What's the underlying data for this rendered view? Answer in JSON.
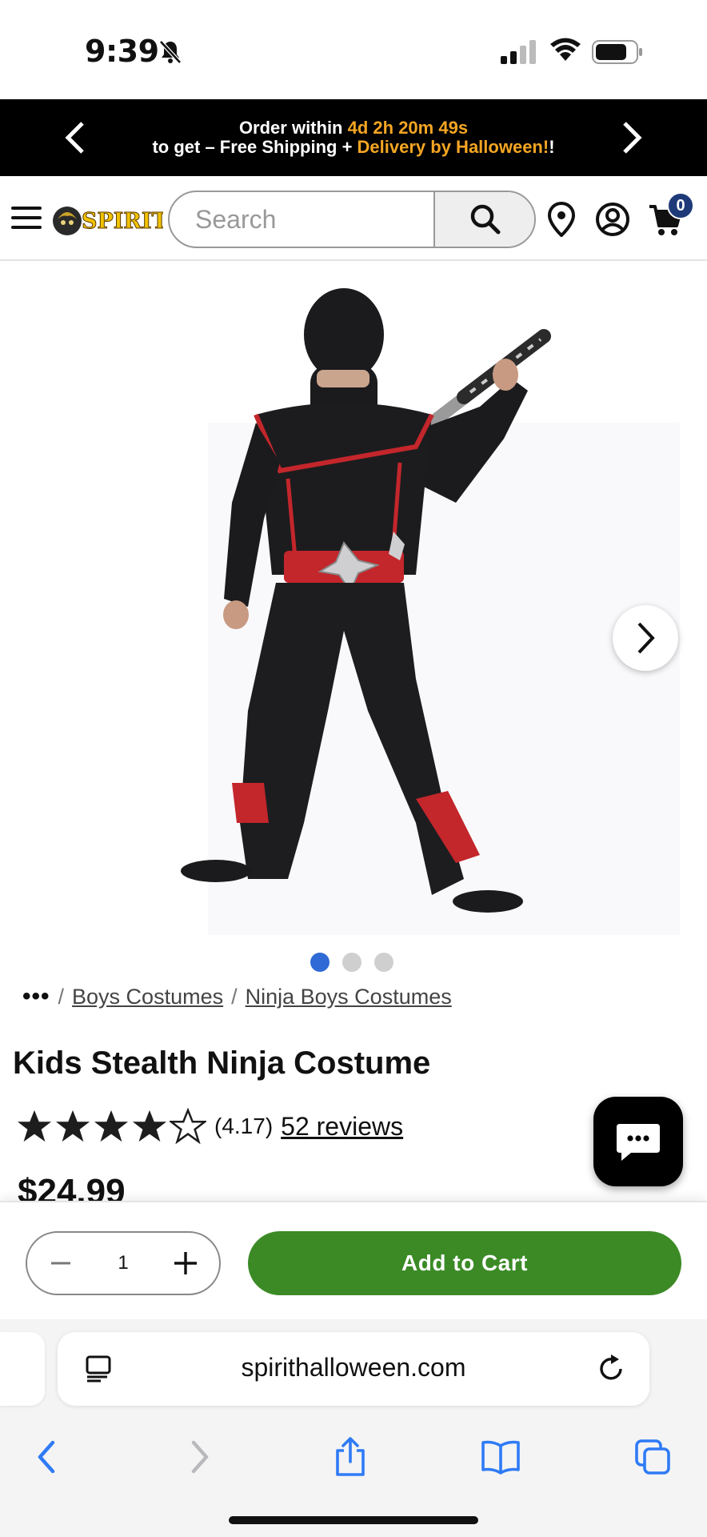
{
  "status_bar": {
    "time": "9:39"
  },
  "promo": {
    "line1_prefix": "Order within ",
    "line1_countdown": "4d 2h 20m 49s",
    "line2_prefix": "to get – Free Shipping + ",
    "line2_highlight": "Delivery by Halloween!",
    "line2_suffix": "!"
  },
  "header": {
    "logo_text": "SPIRIT",
    "search_placeholder": "Search",
    "cart_count": "0"
  },
  "gallery": {
    "total_images": 3,
    "active_index": 0
  },
  "breadcrumb": {
    "ellipsis": "•••",
    "separator": "/",
    "items": [
      "Boys Costumes",
      "Ninja Boys Costumes"
    ]
  },
  "product": {
    "title": "Kids Stealth Ninja Costume",
    "rating_stars": 4,
    "rating_text": "(4.17)",
    "reviews_label": "52 reviews",
    "price": "$24.99"
  },
  "cart_bar": {
    "quantity": "1",
    "add_to_cart_label": "Add to Cart"
  },
  "browser": {
    "url": "spirithalloween.com"
  },
  "colors": {
    "promo_highlight": "#f5a623",
    "add_to_cart": "#3b8a26",
    "cart_badge": "#1e3a78",
    "active_dot": "#2f6ad6",
    "safari_blue": "#2f7bf6"
  },
  "icons": [
    "bell-slash-icon",
    "signal-icon",
    "wifi-icon",
    "battery-icon",
    "chevron-left-icon",
    "chevron-right-icon",
    "hamburger-icon",
    "search-icon",
    "location-pin-icon",
    "account-icon",
    "cart-icon",
    "chat-icon",
    "minus-icon",
    "plus-icon",
    "reader-icon",
    "reload-icon",
    "back-icon",
    "forward-icon",
    "share-icon",
    "bookmarks-icon",
    "tabs-icon"
  ]
}
